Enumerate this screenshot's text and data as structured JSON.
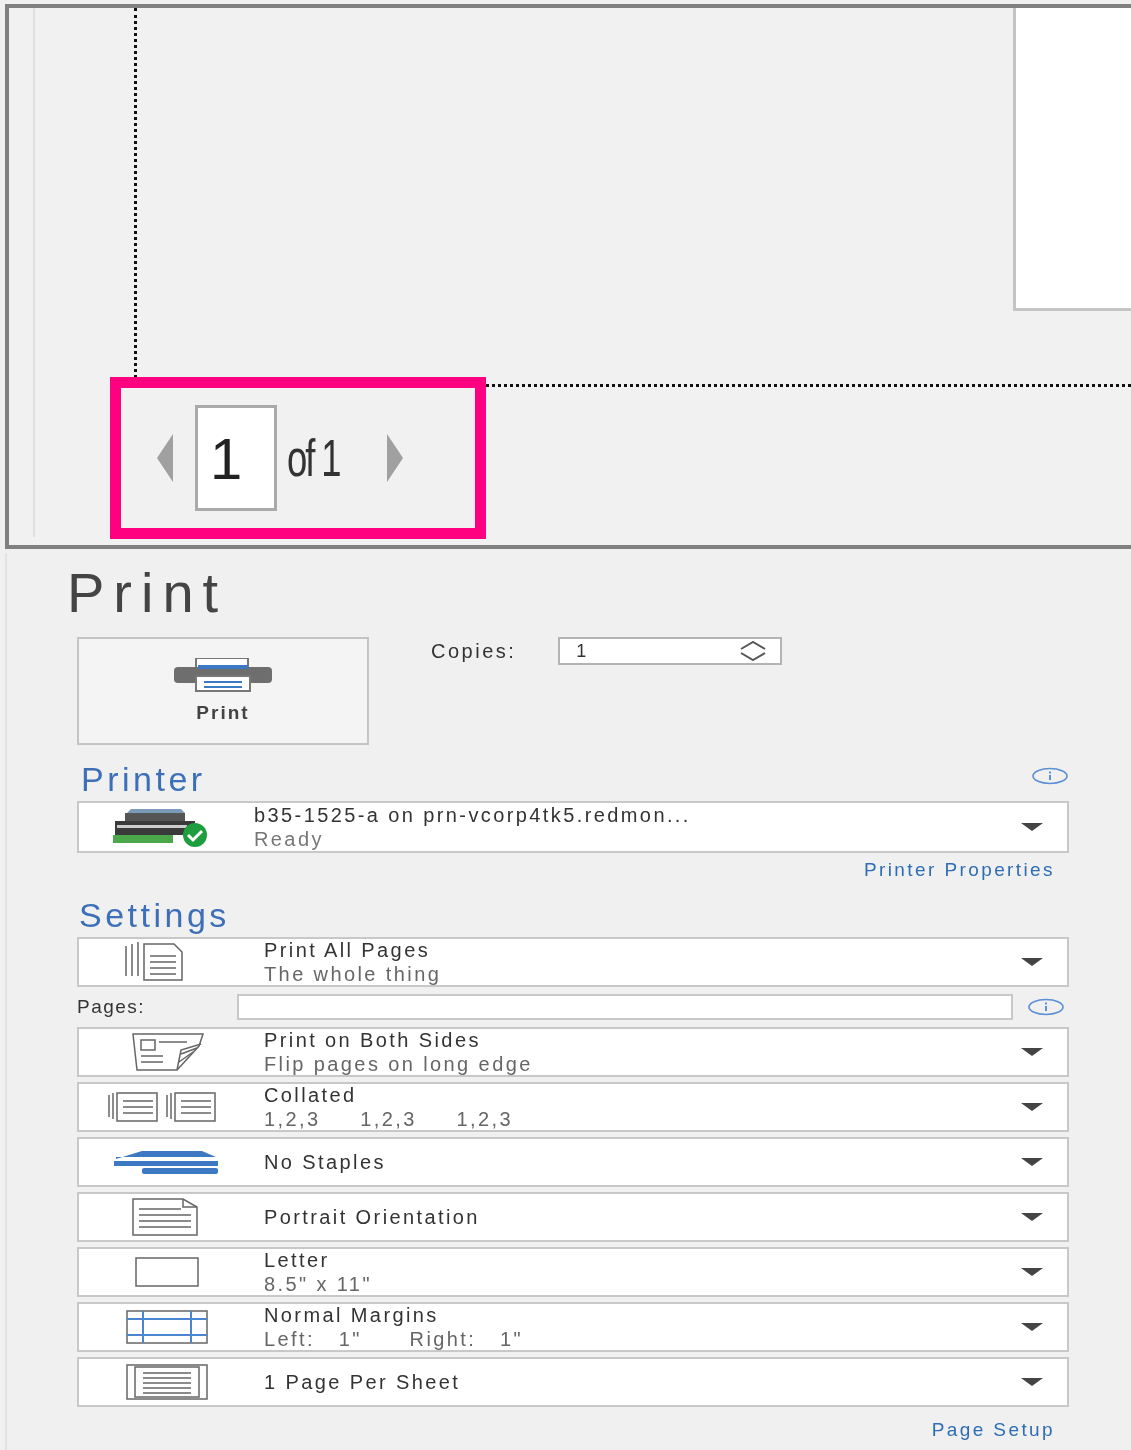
{
  "preview": {
    "page_nav": {
      "page": "1",
      "of": "of 1"
    }
  },
  "title": "Print",
  "print_button": {
    "label": "Print"
  },
  "copies": {
    "label": "Copies:",
    "value": "1"
  },
  "printer": {
    "heading": "Printer",
    "name": "b35-1525-a on prn-vcorp4tk5.redmon...",
    "status": "Ready",
    "properties_link": "Printer Properties"
  },
  "settings": {
    "heading": "Settings",
    "pages_label": "Pages:",
    "page_setup_link": "Page Setup",
    "items": [
      {
        "title": "Print All Pages",
        "subtitle": "The whole thing"
      },
      {
        "title": "Print on Both Sides",
        "subtitle": "Flip pages on long edge"
      },
      {
        "title": "Collated",
        "subtitle": "1,2,3     1,2,3     1,2,3"
      },
      {
        "title": "No Staples"
      },
      {
        "title": "Portrait Orientation"
      },
      {
        "title": "Letter",
        "subtitle": "8.5\" x 11\""
      },
      {
        "title": "Normal Margins",
        "subtitle": "Left:   1\"      Right:   1\""
      },
      {
        "title": "1 Page Per Sheet"
      }
    ]
  }
}
